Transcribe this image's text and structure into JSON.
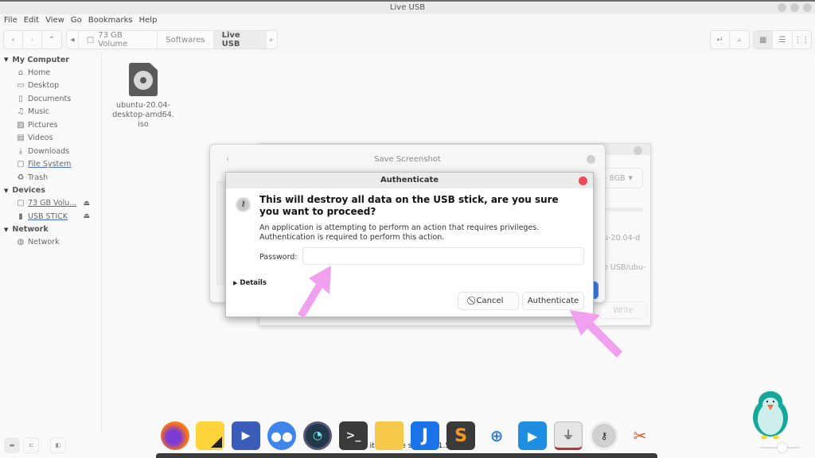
{
  "window": {
    "title": "Live USB"
  },
  "menubar": [
    "File",
    "Edit",
    "View",
    "Go",
    "Bookmarks",
    "Help"
  ],
  "breadcrumb": {
    "items": [
      {
        "label": "73 GB Volume",
        "icon": "drive-icon"
      },
      {
        "label": "Softwares"
      },
      {
        "label": "Live USB",
        "active": true
      }
    ]
  },
  "sidebar": {
    "sections": [
      {
        "label": "My Computer",
        "items": [
          {
            "label": "Home",
            "icon": "home-icon",
            "glyph": "⌂"
          },
          {
            "label": "Desktop",
            "icon": "desktop-icon",
            "glyph": "▭"
          },
          {
            "label": "Documents",
            "icon": "documents-icon",
            "glyph": "🗋"
          },
          {
            "label": "Music",
            "icon": "music-icon",
            "glyph": "♫"
          },
          {
            "label": "Pictures",
            "icon": "pictures-icon",
            "glyph": "▨"
          },
          {
            "label": "Videos",
            "icon": "videos-icon",
            "glyph": "▤"
          },
          {
            "label": "Downloads",
            "icon": "downloads-icon",
            "glyph": "⤓"
          },
          {
            "label": "File System",
            "icon": "drive-icon",
            "glyph": "▢",
            "underlined": true
          },
          {
            "label": "Trash",
            "icon": "trash-icon",
            "glyph": "🗑"
          }
        ]
      },
      {
        "label": "Devices",
        "items": [
          {
            "label": "73 GB Volu...",
            "icon": "drive-icon",
            "glyph": "▢",
            "underlined": true,
            "eject": true
          },
          {
            "label": "USB STICK",
            "icon": "usb-icon",
            "glyph": "▮",
            "underlined": true,
            "eject": true
          }
        ]
      },
      {
        "label": "Network",
        "items": [
          {
            "label": "Network",
            "icon": "network-icon",
            "glyph": "◍"
          }
        ]
      }
    ]
  },
  "files": [
    {
      "name": "ubuntu-20.04-desktop-amd64.iso",
      "line1": "ubuntu-20.04-",
      "line2": "desktop-amd64.",
      "line3": "iso"
    }
  ],
  "background_windows": {
    "save_screenshot_title": "Save Screenshot",
    "usb_writer": {
      "device": "- 8GB",
      "file_fragment": "u-20.04-d",
      "path_fragment": "e USB/ubu-",
      "write_label": "Write"
    }
  },
  "auth_dialog": {
    "title": "Authenticate",
    "heading": "This will destroy all data on the USB stick, are you sure you want to proceed?",
    "message": "An application is attempting to perform an action that requires privileges. Authentication is required to perform this action.",
    "password_label": "Password:",
    "password_value": "",
    "details_label": "Details",
    "cancel_label": "Cancel",
    "authenticate_label": "Authenticate"
  },
  "statusbar": {
    "text": "1 item, Free space: 61.5"
  },
  "dock": {
    "apps": [
      {
        "name": "firefox"
      },
      {
        "name": "sticky-notes"
      },
      {
        "name": "video-editor"
      },
      {
        "name": "discord"
      },
      {
        "name": "speedometer"
      },
      {
        "name": "terminal"
      },
      {
        "name": "files"
      },
      {
        "name": "joplin"
      },
      {
        "name": "sublime-text"
      },
      {
        "name": "add-app"
      },
      {
        "name": "media-player"
      },
      {
        "name": "usb-creator"
      },
      {
        "name": "keyring"
      },
      {
        "name": "screenshot-tool"
      }
    ]
  },
  "colors": {
    "close_red": "#ef4b55",
    "annotation_arrow": "#f0a0ef",
    "link_underline": "#3b6fd6"
  }
}
